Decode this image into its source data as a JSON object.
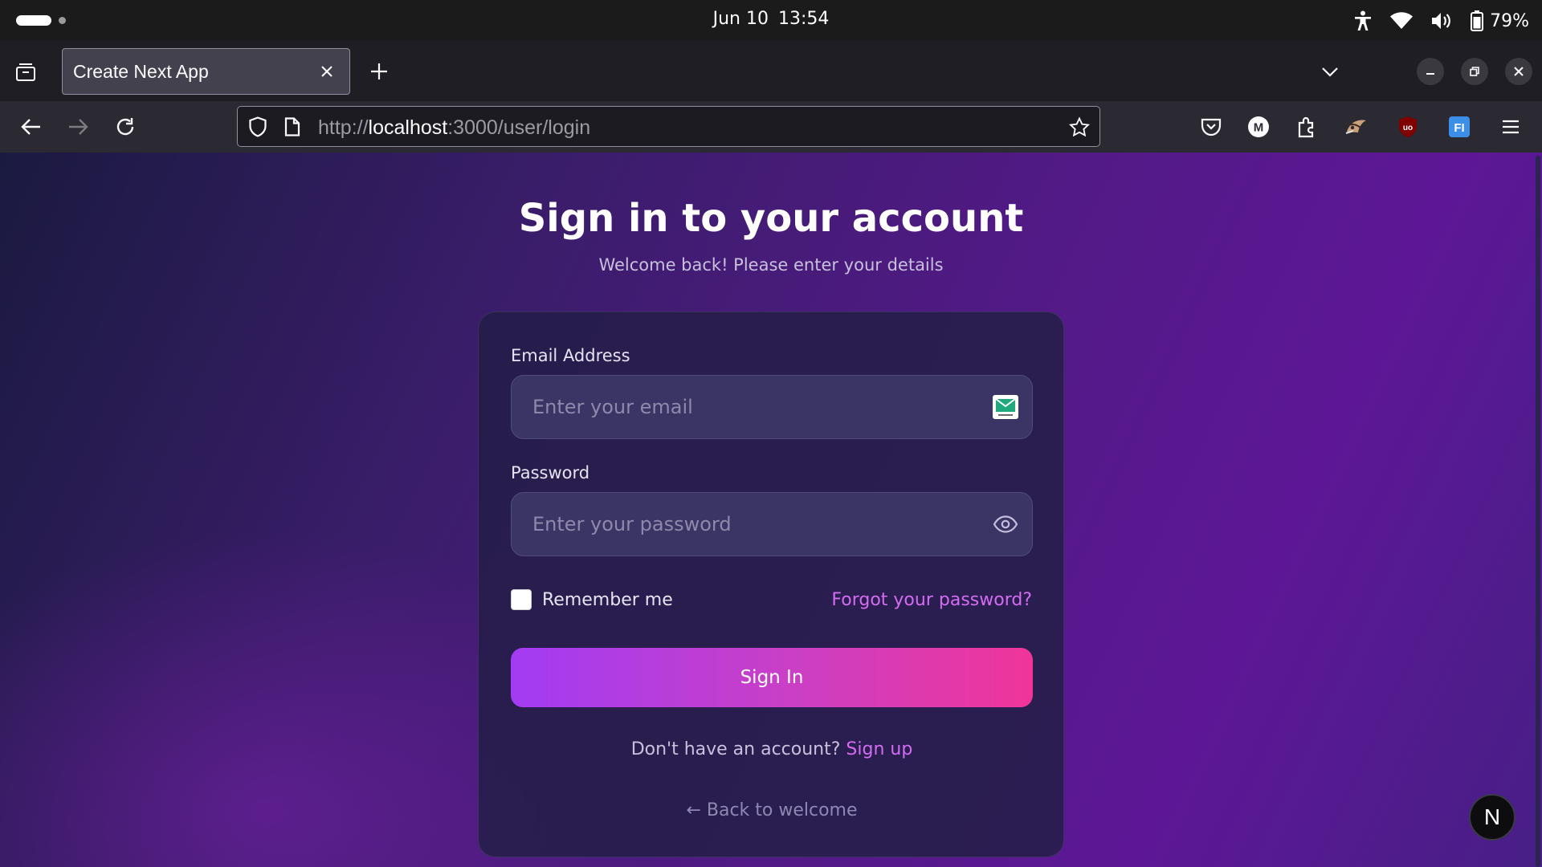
{
  "os": {
    "date": "Jun 10",
    "time": "13:54",
    "battery_percent": "79%",
    "icons": [
      "accessibility-icon",
      "wifi-icon",
      "volume-icon",
      "battery-icon"
    ]
  },
  "browser": {
    "tab_title": "Create Next App",
    "url_scheme": "http://",
    "url_host": "localhost",
    "url_rest": ":3000/user/login",
    "extensions": [
      "pocket-icon",
      "m-extension-icon",
      "extensions-icon",
      "custom-extension-icon",
      "ublock-icon",
      "fi-extension-icon"
    ],
    "extension_labels": {
      "m": "M",
      "ublock": "uo",
      "fi": "FI"
    }
  },
  "login": {
    "title": "Sign in to your account",
    "subtitle": "Welcome back! Please enter your details",
    "email_label": "Email Address",
    "email_placeholder": "Enter your email",
    "email_value": "",
    "password_label": "Password",
    "password_placeholder": "Enter your password",
    "password_value": "",
    "remember_label": "Remember me",
    "remember_checked": false,
    "forgot_link": "Forgot your password?",
    "submit_label": "Sign In",
    "signup_prompt": "Don't have an account?",
    "signup_link": "Sign up",
    "back_link": "← Back to welcome"
  },
  "next_badge": "N",
  "colors": {
    "accent_link": "#d46cf2",
    "button_gradient_start": "#a23cf4",
    "button_gradient_end": "#f0359a",
    "page_bg_dark": "#1a1a40",
    "page_bg_purple": "#5d1796"
  }
}
